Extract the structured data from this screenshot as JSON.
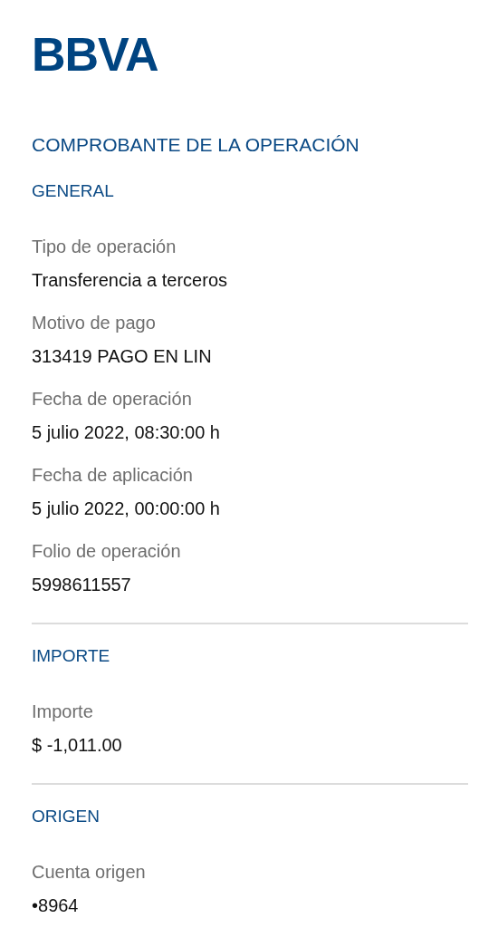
{
  "logo": "BBVA",
  "title": "COMPROBANTE DE LA OPERACIÓN",
  "sections": [
    {
      "heading": "GENERAL",
      "fields": [
        {
          "label": "Tipo de operación",
          "value": "Transferencia a terceros"
        },
        {
          "label": "Motivo de pago",
          "value": "313419 PAGO EN LIN"
        },
        {
          "label": "Fecha de operación",
          "value": "5 julio 2022, 08:30:00 h"
        },
        {
          "label": "Fecha de aplicación",
          "value": "5 julio 2022, 00:00:00 h"
        },
        {
          "label": "Folio de operación",
          "value": "5998611557"
        }
      ]
    },
    {
      "heading": "IMPORTE",
      "fields": [
        {
          "label": "Importe",
          "value": "$ -1,011.00"
        }
      ]
    },
    {
      "heading": "ORIGEN",
      "fields": [
        {
          "label": "Cuenta origen",
          "value": "•8964"
        }
      ]
    }
  ]
}
